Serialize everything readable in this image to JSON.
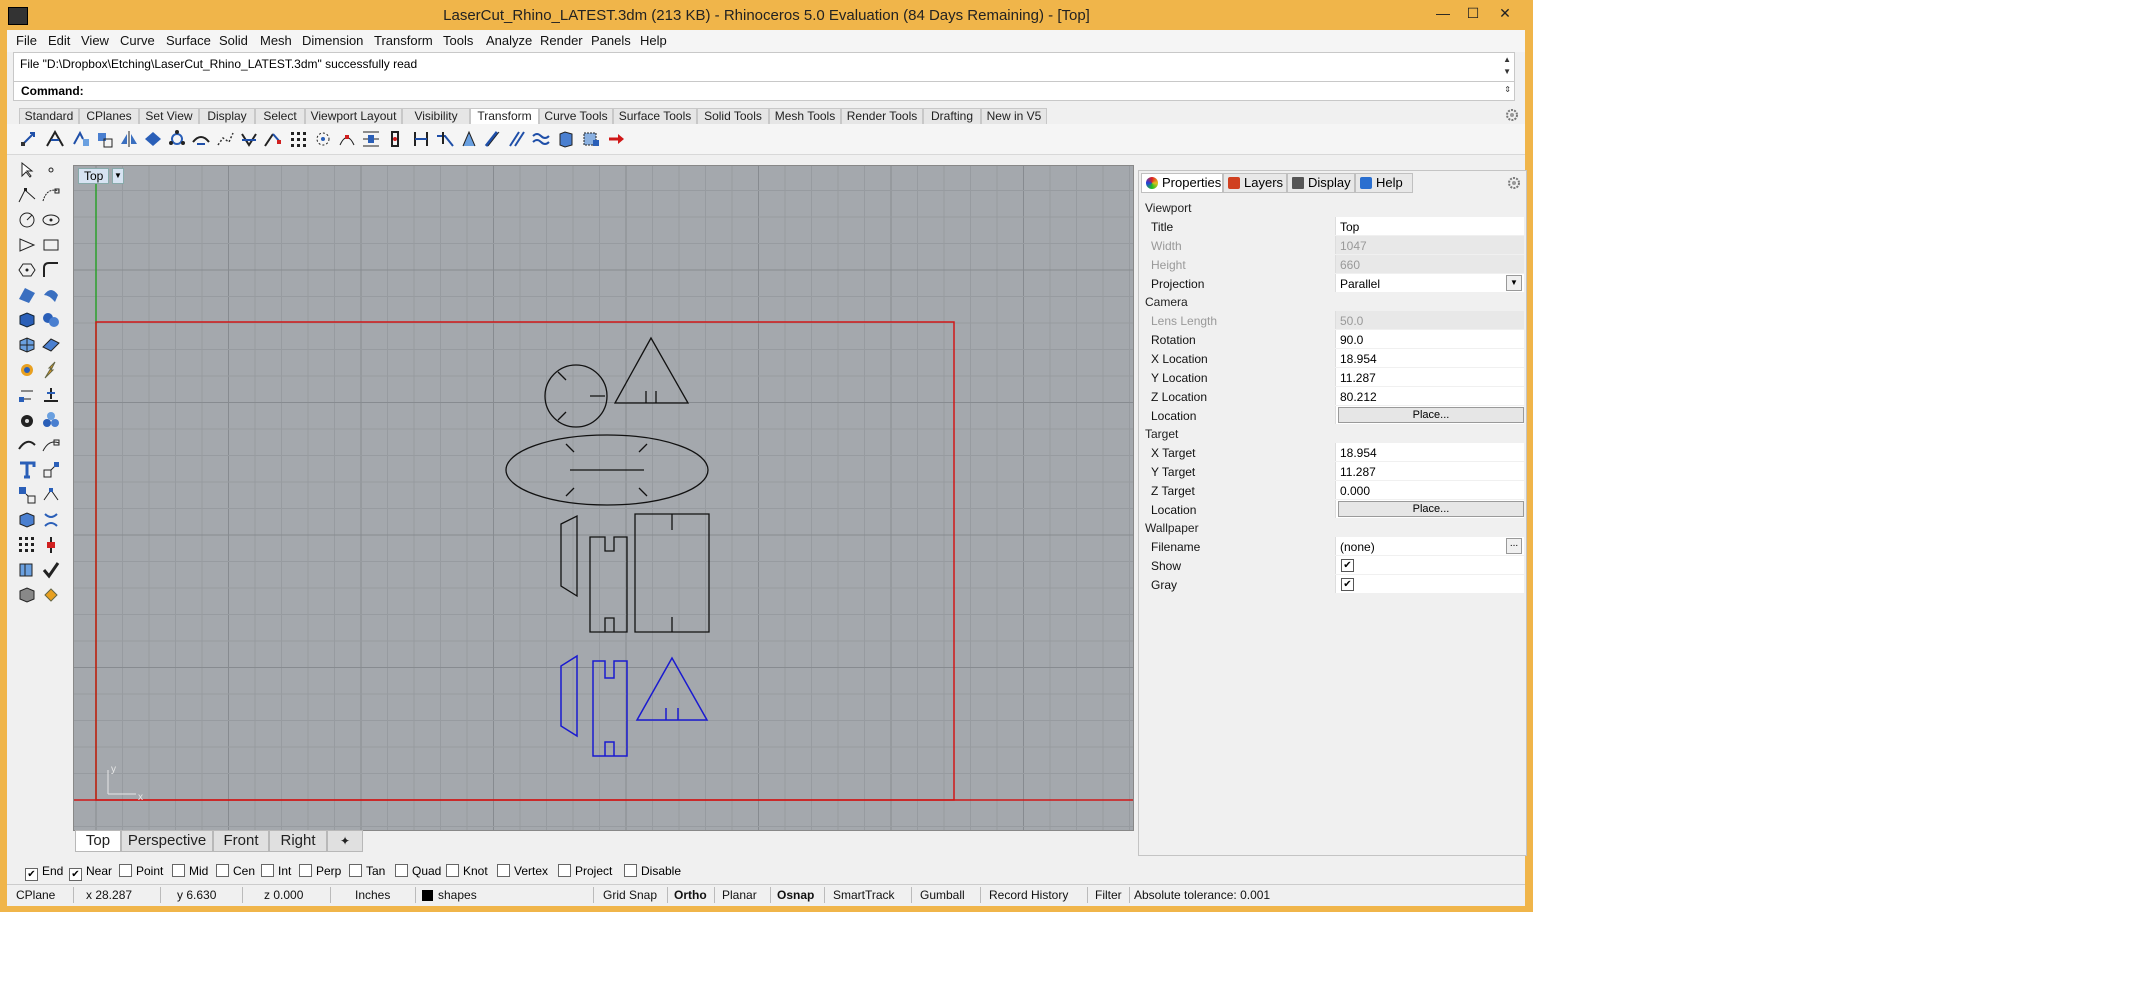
{
  "window": {
    "title": "LaserCut_Rhino_LATEST.3dm (213 KB) - Rhinoceros 5.0 Evaluation (84 Days Remaining) - [Top]",
    "minimize": "—",
    "maximize": "☐",
    "close": "✕"
  },
  "menu": [
    "File",
    "Edit",
    "View",
    "Curve",
    "Surface",
    "Solid",
    "Mesh",
    "Dimension",
    "Transform",
    "Tools",
    "Analyze",
    "Render",
    "Panels",
    "Help"
  ],
  "command": {
    "history": "File \"D:\\Dropbox\\Etching\\LaserCut_Rhino_LATEST.3dm\" successfully read",
    "label": "Command:",
    "value": ""
  },
  "toolbar_tabs": [
    "Standard",
    "CPlanes",
    "Set View",
    "Display",
    "Select",
    "Viewport Layout",
    "Visibility",
    "Transform",
    "Curve Tools",
    "Surface Tools",
    "Solid Tools",
    "Mesh Tools",
    "Render Tools",
    "Drafting",
    "New in V5"
  ],
  "toolbar_active": "Transform",
  "viewport": {
    "name": "Top"
  },
  "view_tabs": [
    "Top",
    "Perspective",
    "Front",
    "Right"
  ],
  "view_tab_add": "✦",
  "panel": {
    "tabs": [
      "Properties",
      "Layers",
      "Display",
      "Help"
    ],
    "sections": {
      "viewport": "Viewport",
      "camera": "Camera",
      "target": "Target",
      "wallpaper": "Wallpaper"
    },
    "rows": {
      "title": {
        "label": "Title",
        "value": "Top"
      },
      "width": {
        "label": "Width",
        "value": "1047"
      },
      "height": {
        "label": "Height",
        "value": "660"
      },
      "projection": {
        "label": "Projection",
        "value": "Parallel"
      },
      "lens": {
        "label": "Lens Length",
        "value": "50.0"
      },
      "rotation": {
        "label": "Rotation",
        "value": "90.0"
      },
      "xloc": {
        "label": "X Location",
        "value": "18.954"
      },
      "yloc": {
        "label": "Y Location",
        "value": "11.287"
      },
      "zloc": {
        "label": "Z Location",
        "value": "80.212"
      },
      "camloc": {
        "label": "Location",
        "button": "Place..."
      },
      "xtar": {
        "label": "X Target",
        "value": "18.954"
      },
      "ytar": {
        "label": "Y Target",
        "value": "11.287"
      },
      "ztar": {
        "label": "Z Target",
        "value": "0.000"
      },
      "tarloc": {
        "label": "Location",
        "button": "Place..."
      },
      "filename": {
        "label": "Filename",
        "value": "(none)",
        "button": "..."
      },
      "show": {
        "label": "Show",
        "checked": true
      },
      "gray": {
        "label": "Gray",
        "checked": true
      }
    }
  },
  "osnaps": [
    {
      "label": "End",
      "checked": true
    },
    {
      "label": "Near",
      "checked": true
    },
    {
      "label": "Point",
      "checked": false
    },
    {
      "label": "Mid",
      "checked": false
    },
    {
      "label": "Cen",
      "checked": false
    },
    {
      "label": "Int",
      "checked": false
    },
    {
      "label": "Perp",
      "checked": false
    },
    {
      "label": "Tan",
      "checked": false
    },
    {
      "label": "Quad",
      "checked": false
    },
    {
      "label": "Knot",
      "checked": false
    },
    {
      "label": "Vertex",
      "checked": false
    },
    {
      "label": "Project",
      "checked": false
    },
    {
      "label": "Disable",
      "checked": false
    }
  ],
  "status": {
    "cplane": "CPlane",
    "x": "x 28.287",
    "y": "y 6.630",
    "z": "z 0.000",
    "units": "Inches",
    "layer": "shapes",
    "grid_snap": "Grid Snap",
    "ortho": "Ortho",
    "planar": "Planar",
    "osnap": "Osnap",
    "smarttrack": "SmartTrack",
    "gumball": "Gumball",
    "record_history": "Record History",
    "filter": "Filter",
    "tolerance": "Absolute tolerance: 0.001"
  },
  "colors": {
    "frame": "#f0b54a",
    "viewport_bg": "#a4a8ad",
    "grid": "#8f9398",
    "boundary": "#d01818",
    "shapes": "#000000",
    "selected": "#1a1ad0"
  }
}
